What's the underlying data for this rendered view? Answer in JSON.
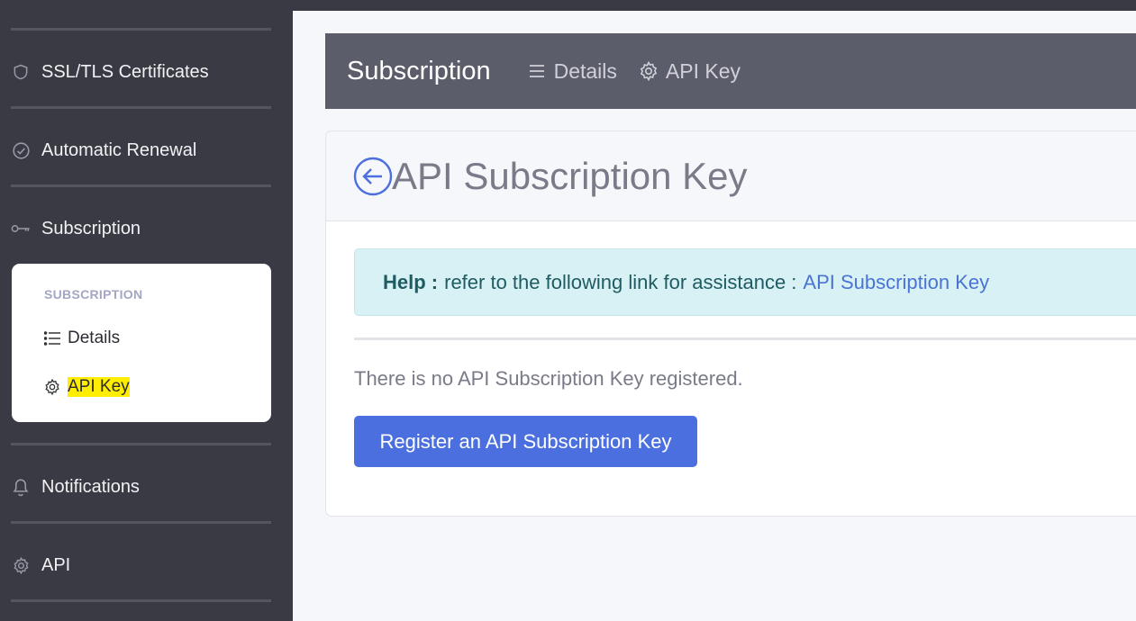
{
  "sidebar": {
    "items": [
      {
        "label": "SSL/TLS Certificates",
        "icon": "shield-icon"
      },
      {
        "label": "Automatic Renewal",
        "icon": "check-circle-icon"
      },
      {
        "label": "Subscription",
        "icon": "key-icon"
      },
      {
        "label": "Notifications",
        "icon": "bell-icon"
      },
      {
        "label": "API",
        "icon": "gear-icon"
      }
    ],
    "submenu": {
      "title": "SUBSCRIPTION",
      "items": [
        {
          "label": "Details",
          "icon": "list-icon"
        },
        {
          "label": "API Key",
          "icon": "gear-icon",
          "highlighted": true
        }
      ]
    }
  },
  "subnav": {
    "title": "Subscription",
    "links": [
      {
        "label": "Details",
        "icon": "list-icon"
      },
      {
        "label": "API Key",
        "icon": "gear-icon"
      }
    ]
  },
  "card": {
    "title": "API Subscription Key",
    "alert": {
      "help_label": "Help :",
      "message": "refer to the following link for assistance :",
      "link_text": "API Subscription Key"
    },
    "empty_message": "There is no API Subscription Key registered.",
    "register_button": "Register an API Subscription Key"
  },
  "colors": {
    "sidebar_bg": "#3a3a45",
    "subnav_bg": "#5c5d6b",
    "primary": "#4c6fe0",
    "alert_bg": "#d8f1f4",
    "highlight": "#ffee00"
  }
}
